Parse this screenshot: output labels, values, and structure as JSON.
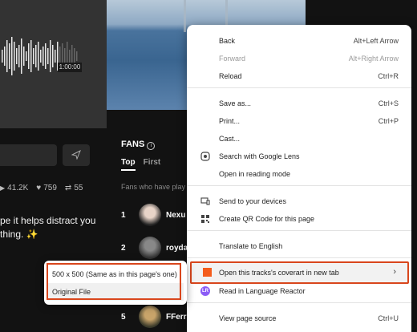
{
  "player": {
    "timestamp": "1:00:00"
  },
  "stats": {
    "plays": "41.2K",
    "likes": "759",
    "reposts": "55"
  },
  "lyric_lines": [
    "pe it helps distract you",
    "thing. ✨"
  ],
  "fans": {
    "title": "FANS",
    "tabs": [
      "Top",
      "First"
    ],
    "description": "Fans who have play",
    "list": [
      {
        "rank": "1",
        "name": "Nexu"
      },
      {
        "rank": "2",
        "name": "royda"
      },
      {
        "rank": "3",
        "name": ""
      },
      {
        "rank": "4",
        "name": ""
      },
      {
        "rank": "5",
        "name": "FFerr"
      }
    ]
  },
  "context_menu": {
    "items": [
      {
        "label": "Back",
        "shortcut": "Alt+Left Arrow"
      },
      {
        "label": "Forward",
        "shortcut": "Alt+Right Arrow",
        "disabled": true
      },
      {
        "label": "Reload",
        "shortcut": "Ctrl+R"
      },
      {
        "label": "Save as...",
        "shortcut": "Ctrl+S"
      },
      {
        "label": "Print...",
        "shortcut": "Ctrl+P"
      },
      {
        "label": "Cast..."
      },
      {
        "label": "Search with Google Lens",
        "icon": "lens-icon"
      },
      {
        "label": "Open in reading mode"
      },
      {
        "label": "Send to your devices",
        "icon": "devices-icon"
      },
      {
        "label": "Create QR Code for this page",
        "icon": "qr-icon"
      },
      {
        "label": "Translate to English"
      },
      {
        "label": "Open this tracks's coverart in new tab",
        "icon": "extension-orange-icon",
        "submenu": true
      },
      {
        "label": "Read in Language Reactor",
        "icon": "language-reactor-icon"
      },
      {
        "label": "View page source",
        "shortcut": "Ctrl+U"
      }
    ]
  },
  "submenu": {
    "items": [
      "500 x 500 (Same as in this page's one)",
      "Original File"
    ]
  },
  "colors": {
    "highlight_border": "#d9461c",
    "extension_orange": "#f45c1c"
  }
}
